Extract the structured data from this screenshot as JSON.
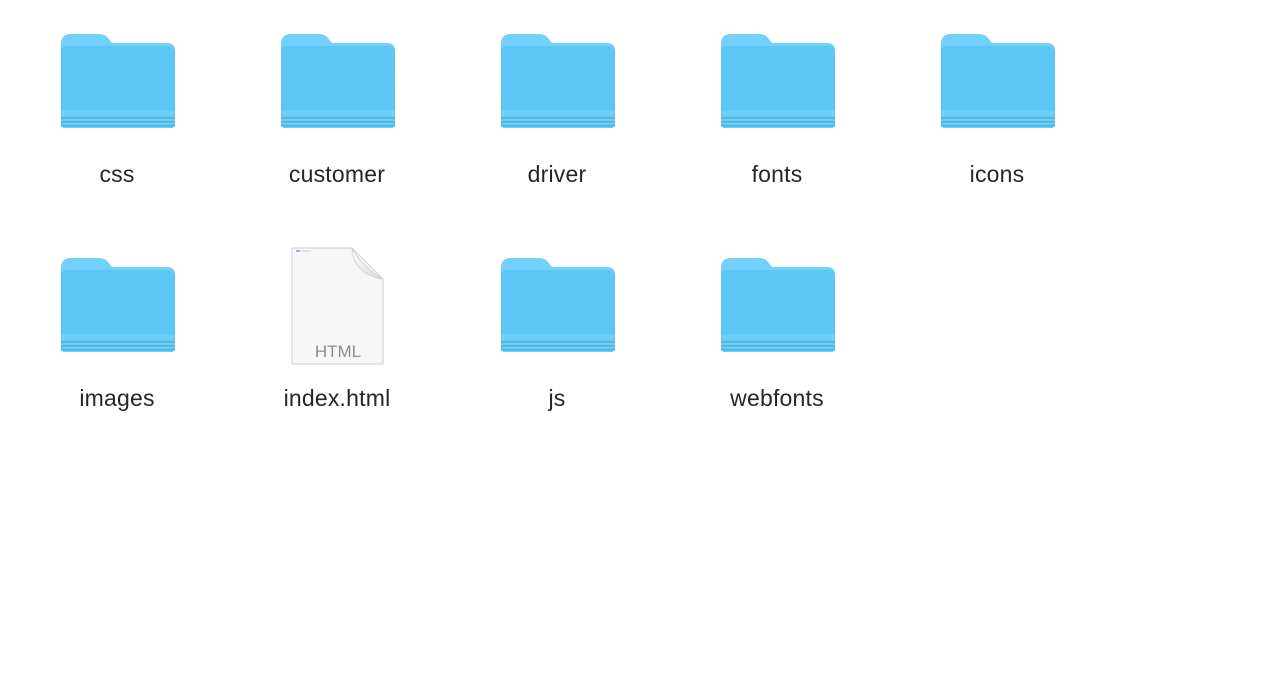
{
  "items": [
    {
      "name": "css",
      "kind": "folder",
      "icon": "folder-icon"
    },
    {
      "name": "customer",
      "kind": "folder",
      "icon": "folder-icon"
    },
    {
      "name": "driver",
      "kind": "folder",
      "icon": "folder-icon"
    },
    {
      "name": "fonts",
      "kind": "folder",
      "icon": "folder-icon"
    },
    {
      "name": "icons",
      "kind": "folder",
      "icon": "folder-icon"
    },
    {
      "name": "images",
      "kind": "folder",
      "icon": "folder-icon"
    },
    {
      "name": "index.html",
      "kind": "file",
      "icon": "html-file-icon",
      "badge": "HTML"
    },
    {
      "name": "js",
      "kind": "folder",
      "icon": "folder-icon"
    },
    {
      "name": "webfonts",
      "kind": "folder",
      "icon": "folder-icon"
    }
  ],
  "colors": {
    "folder_back": "#6ecdf8",
    "folder_front": "#5ec5f7",
    "label_text": "#262626"
  }
}
